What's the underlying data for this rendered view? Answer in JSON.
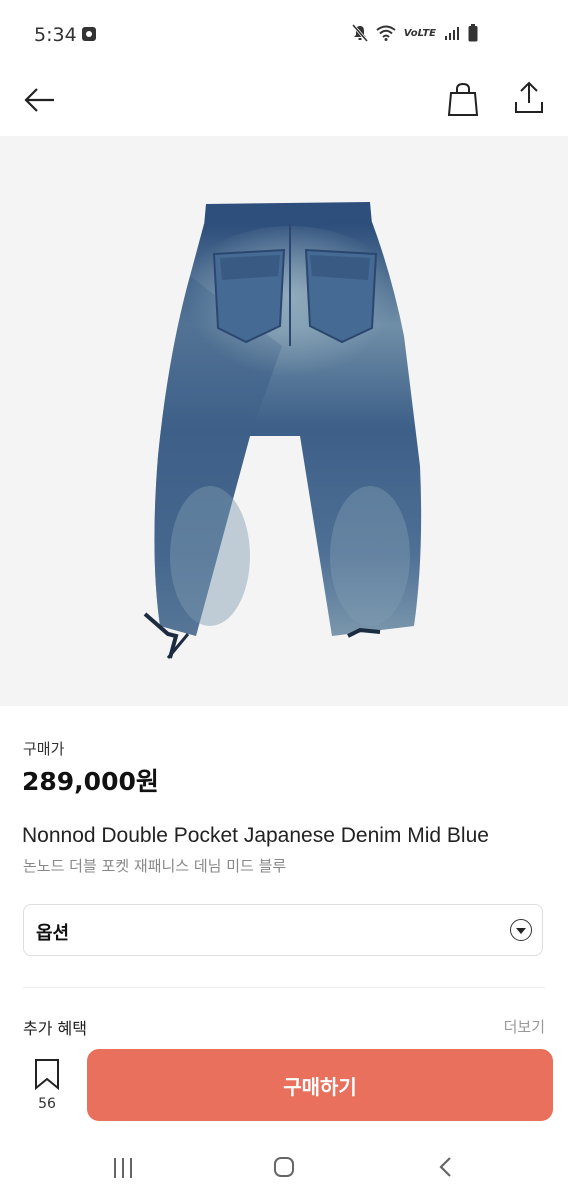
{
  "status_bar": {
    "time": "5:34",
    "network": "VoLTE"
  },
  "header": {
    "back_icon": "arrow-left-icon",
    "bag_icon": "shopping-bag-icon",
    "share_icon": "share-icon"
  },
  "product": {
    "price_label": "구매가",
    "price": "289,000원",
    "title": "Nonnod Double Pocket Japanese Denim Mid Blue",
    "subtitle": "논노드 더블 포켓 재패니스 데님 미드 블루"
  },
  "option": {
    "label": "옵션"
  },
  "benefits": {
    "label": "추가 혜택",
    "more": "더보기"
  },
  "action_bar": {
    "bookmark_count": "56",
    "buy_label": "구매하기"
  },
  "colors": {
    "buy_button": "#e8705c",
    "image_background": "#f4f4f4",
    "denim": "#3f5e86"
  }
}
